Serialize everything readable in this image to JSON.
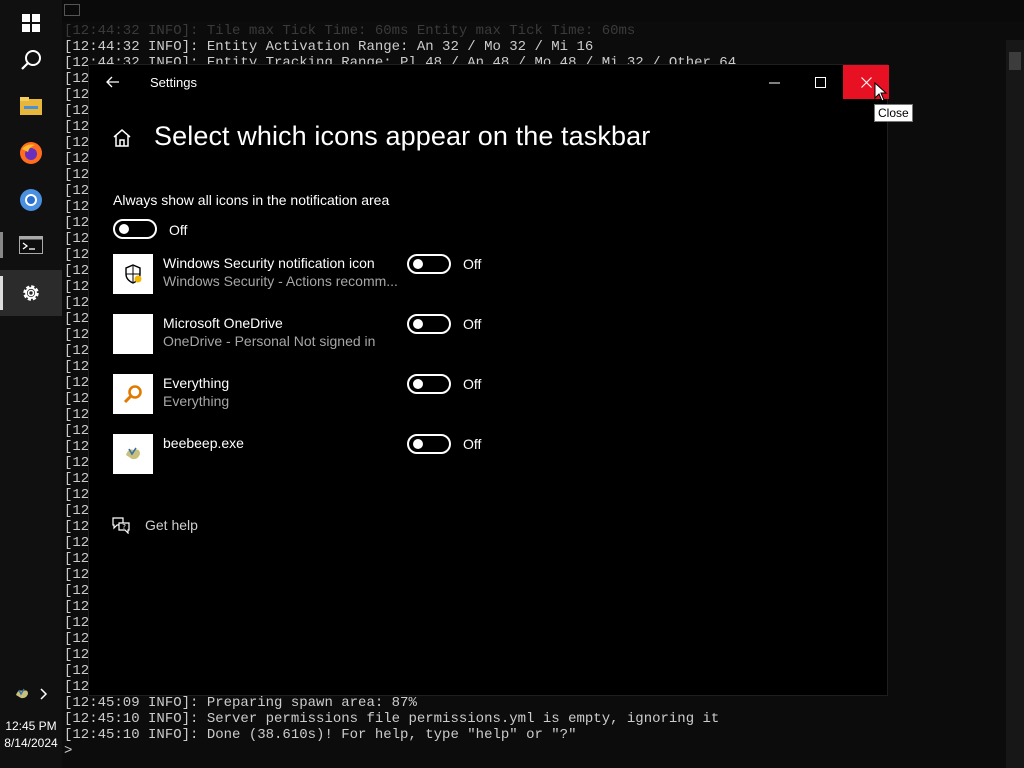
{
  "taskbar": {
    "icons": [
      {
        "name": "windows-start-icon"
      },
      {
        "name": "search-icon"
      },
      {
        "name": "file-explorer-icon"
      },
      {
        "name": "firefox-icon"
      },
      {
        "name": "chrome-icon"
      },
      {
        "name": "terminal-icon"
      },
      {
        "name": "settings-gear-icon"
      }
    ],
    "clock_time": "12:45 PM",
    "clock_date": "8/14/2024"
  },
  "console": {
    "title_faint": "[12:44:32 INFO]: Tile max Tick Time: 60ms Entity max Tick Time: 60ms",
    "top_lines": [
      "[12:44:32 INFO]: Entity Activation Range: An 32 / Mo 32 / Mi 16",
      "[12:44:32 INFO]: Entity Tracking Range: Pl 48 / An 48 / Mo 48 / Mi 32 / Other 64"
    ],
    "left_fragment": "[12",
    "bottom_lines": [
      "[12:45:09 INFO]: Preparing spawn area: 87%",
      "[12:45:10 INFO]: Server permissions file permissions.yml is empty, ignoring it",
      "[12:45:10 INFO]: Done (38.610s)! For help, type \"help\" or \"?\"",
      ">"
    ]
  },
  "settings": {
    "window_title": "Settings",
    "page_title": "Select which icons appear on the taskbar",
    "always_show_label": "Always show all icons in the notification area",
    "always_show_state": "Off",
    "apps": [
      {
        "name": "Windows Security notification icon",
        "desc": "Windows Security - Actions recomm...",
        "state": "Off",
        "icon": "shield-icon"
      },
      {
        "name": "Microsoft OneDrive",
        "desc": "OneDrive - Personal Not signed in",
        "state": "Off",
        "icon": "onedrive-icon"
      },
      {
        "name": "Everything",
        "desc": "Everything",
        "state": "Off",
        "icon": "everything-search-icon"
      },
      {
        "name": "beebeep.exe",
        "desc": "",
        "state": "Off",
        "icon": "beebeep-icon"
      }
    ],
    "help_label": "Get help"
  },
  "tooltip": "Close",
  "colors": {
    "close_button": "#e81123",
    "secondary_text": "#a6a6a6"
  }
}
